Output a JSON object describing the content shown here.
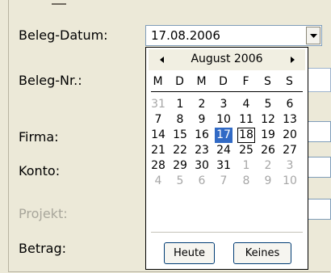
{
  "form": {
    "labels": {
      "beleg_datum": "Beleg-Datum:",
      "beleg_nr": "Beleg-Nr.:",
      "firma": "Firma:",
      "konto": "Konto:",
      "projekt": "Projekt:",
      "betrag": "Betrag:"
    },
    "date_value": "17.08.2006"
  },
  "calendar": {
    "month_label": "August 2006",
    "weekdays": [
      "M",
      "D",
      "M",
      "D",
      "F",
      "S",
      "S"
    ],
    "weeks": [
      [
        "31",
        "1",
        "2",
        "3",
        "4",
        "5",
        "6"
      ],
      [
        "7",
        "8",
        "9",
        "10",
        "11",
        "12",
        "13"
      ],
      [
        "14",
        "15",
        "16",
        "17",
        "18",
        "19",
        "20"
      ],
      [
        "21",
        "22",
        "23",
        "24",
        "25",
        "26",
        "27"
      ],
      [
        "28",
        "29",
        "30",
        "31",
        "1",
        "2",
        "3"
      ],
      [
        "4",
        "5",
        "6",
        "7",
        "8",
        "9",
        "10"
      ]
    ],
    "selected_day": "17",
    "today_day": "18",
    "today_button": "Heute",
    "none_button": "Keines"
  },
  "colors": {
    "selected_bg": "#316ac5",
    "other_month_text": "#a6a6a6",
    "disabled_label": "#a8a69b"
  }
}
